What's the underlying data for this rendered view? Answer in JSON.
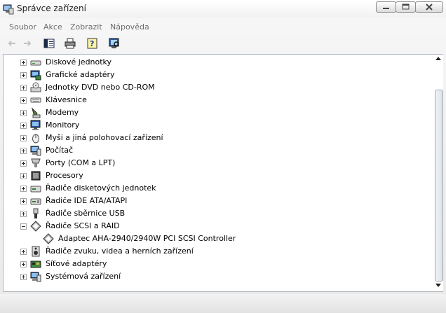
{
  "window": {
    "title": "Správce zařízení"
  },
  "menu": [
    "Soubor",
    "Akce",
    "Zobrazit",
    "Nápověda"
  ],
  "toolbar": [
    {
      "name": "back-arrow-icon",
      "enabled": false
    },
    {
      "name": "forward-arrow-icon",
      "enabled": false
    },
    {
      "name": "show-hide-console-tree-icon",
      "enabled": true
    },
    {
      "name": "print-icon",
      "enabled": true
    },
    {
      "name": "help-icon",
      "enabled": true
    },
    {
      "name": "scan-hardware-icon",
      "enabled": true
    }
  ],
  "tree": [
    {
      "label": "Diskové jednotky",
      "icon": "disk-drive-icon",
      "expander": "plus",
      "indent": 0
    },
    {
      "label": "Grafické adaptéry",
      "icon": "display-adapter-icon",
      "expander": "plus",
      "indent": 0
    },
    {
      "label": "Jednotky DVD nebo CD-ROM",
      "icon": "dvd-drive-icon",
      "expander": "plus",
      "indent": 0
    },
    {
      "label": "Klávesnice",
      "icon": "keyboard-icon",
      "expander": "plus",
      "indent": 0
    },
    {
      "label": "Modemy",
      "icon": "modem-icon",
      "expander": "plus",
      "indent": 0
    },
    {
      "label": "Monitory",
      "icon": "monitor-icon",
      "expander": "plus",
      "indent": 0
    },
    {
      "label": "Myši a jiná polohovací zařízení",
      "icon": "mouse-icon",
      "expander": "plus",
      "indent": 0
    },
    {
      "label": "Počítač",
      "icon": "computer-icon",
      "expander": "plus",
      "indent": 0
    },
    {
      "label": "Porty (COM a LPT)",
      "icon": "port-icon",
      "expander": "plus",
      "indent": 0
    },
    {
      "label": "Procesory",
      "icon": "processor-icon",
      "expander": "plus",
      "indent": 0
    },
    {
      "label": "Řadiče disketových jednotek",
      "icon": "floppy-controller-icon",
      "expander": "plus",
      "indent": 0
    },
    {
      "label": "Řadiče IDE ATA/ATAPI",
      "icon": "ide-controller-icon",
      "expander": "plus",
      "indent": 0
    },
    {
      "label": "Řadiče sběrnice USB",
      "icon": "usb-controller-icon",
      "expander": "plus",
      "indent": 0
    },
    {
      "label": "Řadiče SCSI a RAID",
      "icon": "scsi-controller-icon",
      "expander": "minus",
      "indent": 0
    },
    {
      "label": "Adaptec AHA-2940/2940W PCI SCSI Controller",
      "icon": "scsi-device-icon",
      "expander": "none",
      "indent": 1
    },
    {
      "label": "Řadiče zvuku, videa a herních zařízení",
      "icon": "sound-device-icon",
      "expander": "plus",
      "indent": 0
    },
    {
      "label": "Síťové adaptéry",
      "icon": "network-adapter-icon",
      "expander": "plus",
      "indent": 0
    },
    {
      "label": "Systémová zařízení",
      "icon": "system-device-icon",
      "expander": "plus",
      "indent": 0
    }
  ],
  "colors": {
    "tree_border": "#aeb6bf",
    "menu_text": "#6d6d6d",
    "selection_blue": "#3a6ea5"
  }
}
